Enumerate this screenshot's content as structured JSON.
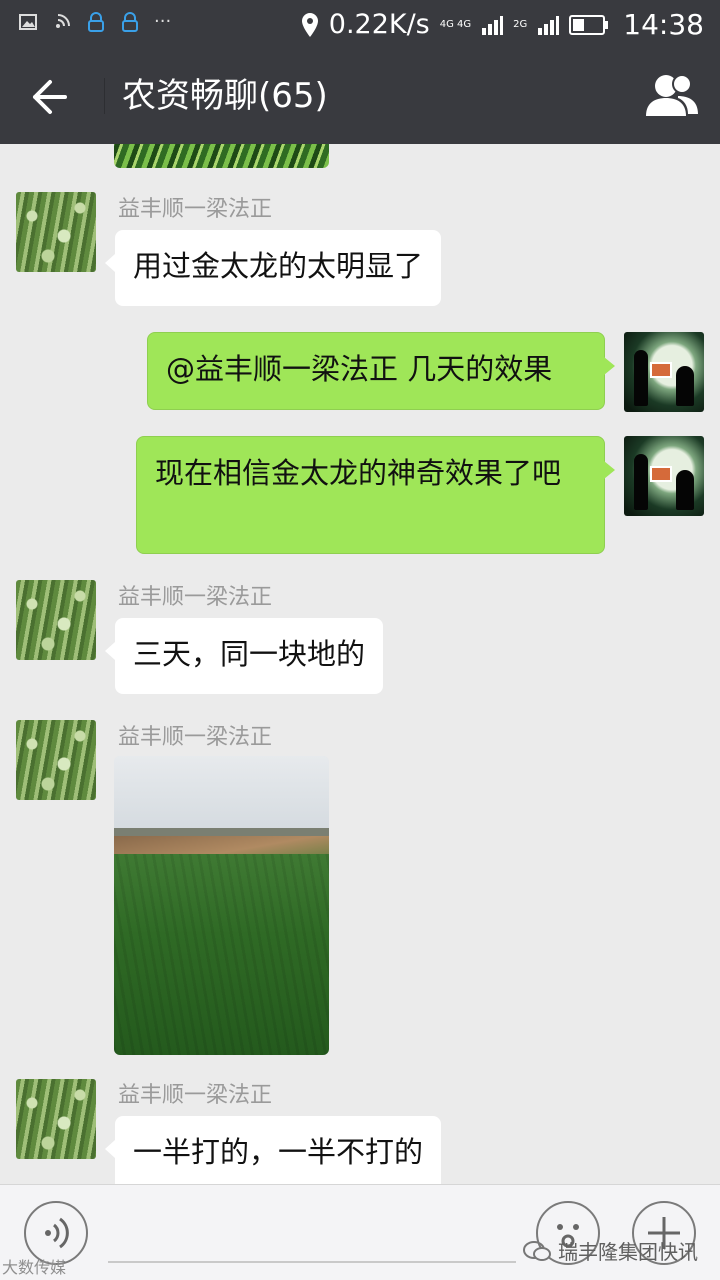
{
  "status_bar": {
    "speed": "0.22K/s",
    "network_1": "4G 4G",
    "network_2": "2G",
    "time": "14:38",
    "icons": [
      "image-icon",
      "hotspot-icon",
      "vpn-icon",
      "vpn-icon",
      "more-dots-icon",
      "location-icon",
      "signal-icon",
      "signal-icon",
      "battery-icon"
    ]
  },
  "header": {
    "title": "农资畅聊(65)",
    "back_icon": "arrow-left-icon",
    "members_icon": "group-members-icon"
  },
  "messages": [
    {
      "direction": "in",
      "sender": "益丰顺一梁法正",
      "type": "text",
      "text": "用过金太龙的太明显了"
    },
    {
      "direction": "out",
      "type": "text",
      "text": "@益丰顺一梁法正  几天的效果"
    },
    {
      "direction": "out",
      "type": "text",
      "text": "现在相信金太龙的神奇效果了吧"
    },
    {
      "direction": "in",
      "sender": "益丰顺一梁法正",
      "type": "text",
      "text": "三天，同一块地的"
    },
    {
      "direction": "in",
      "sender": "益丰顺一梁法正",
      "type": "image"
    },
    {
      "direction": "in",
      "sender": "益丰顺一梁法正",
      "type": "text",
      "text": "一半打的，一半不打的"
    }
  ],
  "bottom_bar": {
    "voice_icon": "voice-icon",
    "emoji_icon": "emoji-icon",
    "plus_icon": "plus-icon"
  },
  "watermarks": {
    "left": "大数传媒",
    "right": "瑞丰隆集团快讯"
  }
}
